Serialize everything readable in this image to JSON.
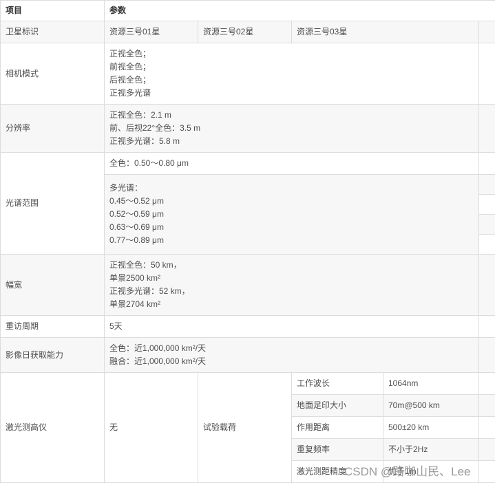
{
  "header": {
    "item": "项目",
    "params": "参数"
  },
  "rows": {
    "satellite": {
      "label": "卫星标识",
      "values": [
        "资源三号01星",
        "资源三号02星",
        "资源三号03星"
      ]
    },
    "camera": {
      "label": "相机模式",
      "lines": [
        "正视全色；",
        "前视全色；",
        "后视全色；",
        "正视多光谱"
      ]
    },
    "resolution": {
      "label": "分辨率",
      "lines": [
        "正视全色：2.1 m",
        "前、后视22°全色：3.5 m",
        "正视多光谱：5.8 m"
      ]
    },
    "spectral": {
      "label": "光谱范围",
      "pan": "全色：0.50～0.80 μm",
      "ms": [
        "多光谱：",
        "0.45～0.52 μm",
        "0.52～0.59 μm",
        "0.63～0.69 μm",
        "0.77～0.89 μm"
      ]
    },
    "swath": {
      "label": "幅宽",
      "lines": [
        "正视全色：50 km，",
        "单景2500 km²",
        "正视多光谱：52 km，",
        "单景2704 km²"
      ]
    },
    "revisit": {
      "label": "重访周期",
      "value": "5天"
    },
    "daily": {
      "label": "影像日获取能力",
      "lines": [
        "全色：近1,000,000 km²/天",
        "融合：近1,000,000 km²/天"
      ]
    },
    "laser": {
      "label": "激光测高仪",
      "sat01": "无",
      "sat02": "试验载荷",
      "params": [
        {
          "name": "工作波长",
          "value": "1064nm"
        },
        {
          "name": "地面足印大小",
          "value": "70m@500 km"
        },
        {
          "name": "作用距离",
          "value": "500±20 km"
        },
        {
          "name": "重复频率",
          "value": "不小于2Hz"
        },
        {
          "name": "激光测距精度",
          "value": "优于1m"
        }
      ]
    }
  },
  "watermark": "CSDN @路咖山民、Lee"
}
